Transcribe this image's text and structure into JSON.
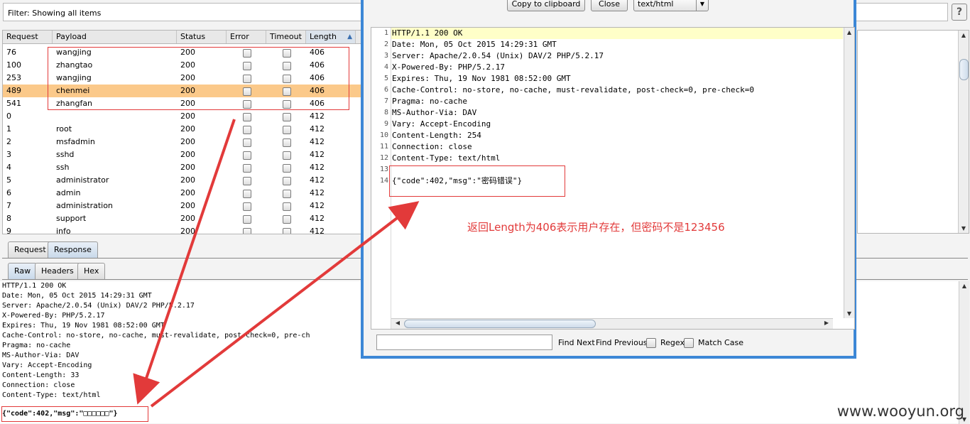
{
  "filter": {
    "text": "Filter: Showing all items",
    "help": "?"
  },
  "table": {
    "columns": [
      "Request",
      "Payload",
      "Status",
      "Error",
      "Timeout",
      "Length"
    ],
    "sort_indicator": "▲",
    "rows": [
      {
        "request": "76",
        "payload": "wangjing",
        "status": "200",
        "length": "406"
      },
      {
        "request": "100",
        "payload": "zhangtao",
        "status": "200",
        "length": "406"
      },
      {
        "request": "253",
        "payload": "wangjing",
        "status": "200",
        "length": "406"
      },
      {
        "request": "489",
        "payload": "chenmei",
        "status": "200",
        "length": "406"
      },
      {
        "request": "541",
        "payload": "zhangfan",
        "status": "200",
        "length": "406"
      },
      {
        "request": "0",
        "payload": "",
        "status": "200",
        "length": "412"
      },
      {
        "request": "1",
        "payload": "root",
        "status": "200",
        "length": "412"
      },
      {
        "request": "2",
        "payload": "msfadmin",
        "status": "200",
        "length": "412"
      },
      {
        "request": "3",
        "payload": "sshd",
        "status": "200",
        "length": "412"
      },
      {
        "request": "4",
        "payload": "ssh",
        "status": "200",
        "length": "412"
      },
      {
        "request": "5",
        "payload": "administrator",
        "status": "200",
        "length": "412"
      },
      {
        "request": "6",
        "payload": "admin",
        "status": "200",
        "length": "412"
      },
      {
        "request": "7",
        "payload": "administration",
        "status": "200",
        "length": "412"
      },
      {
        "request": "8",
        "payload": "support",
        "status": "200",
        "length": "412"
      },
      {
        "request": "9",
        "payload": "info",
        "status": "200",
        "length": "412"
      }
    ]
  },
  "tabs": {
    "request": "Request",
    "response": "Response"
  },
  "subtabs": {
    "raw": "Raw",
    "headers": "Headers",
    "hex": "Hex"
  },
  "raw_lines": [
    "HTTP/1.1 200 OK",
    "Date: Mon, 05 Oct 2015 14:29:31 GMT",
    "Server: Apache/2.0.54 (Unix) DAV/2 PHP/5.2.17",
    "X-Powered-By: PHP/5.2.17",
    "Expires: Thu, 19 Nov 1981 08:52:00 GMT",
    "Cache-Control: no-store, no-cache, must-revalidate, post-check=0, pre-ch",
    "Pragma: no-cache",
    "MS-Author-Via: DAV",
    "Vary: Accept-Encoding",
    "Content-Length: 33",
    "Connection: close",
    "Content-Type: text/html",
    "",
    "{\"code\":402,\"msg\":\"□□□□□□\"}"
  ],
  "popup": {
    "copy_button": "Copy to clipboard",
    "close_button": "Close",
    "content_type": "text/html",
    "lines": [
      "HTTP/1.1 200 OK",
      "Date: Mon, 05 Oct 2015 14:29:31 GMT",
      "Server: Apache/2.0.54 (Unix) DAV/2 PHP/5.2.17",
      "X-Powered-By: PHP/5.2.17",
      "Expires: Thu, 19 Nov 1981 08:52:00 GMT",
      "Cache-Control: no-store, no-cache, must-revalidate, post-check=0, pre-check=0",
      "Pragma: no-cache",
      "MS-Author-Via: DAV",
      "Vary: Accept-Encoding",
      "Content-Length: 254",
      "Connection: close",
      "Content-Type: text/html",
      "",
      "{\"code\":402,\"msg\":\"密码错误\"}"
    ],
    "find_next": "Find Next",
    "find_previous": "Find Previous",
    "regex": "Regex",
    "match_case": "Match Case"
  },
  "annotation": "返回Length为406表示用户存在，但密码不是123456",
  "watermark": "www.wooyun.org",
  "colors": {
    "selected_row": "#fbc98a",
    "annotation": "#e23a3a",
    "window_frame": "#3c87d6",
    "current_line": "#ffffc8"
  }
}
